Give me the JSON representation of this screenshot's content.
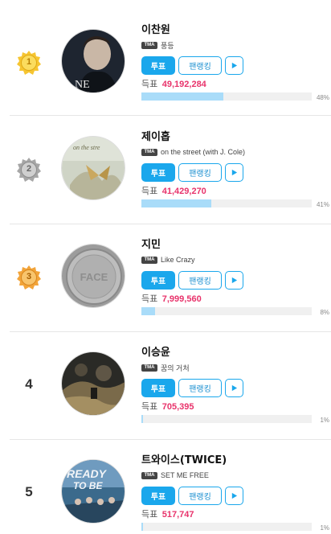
{
  "labels": {
    "vote_button": "투표",
    "fan_ranking_button": "팬랭킹",
    "votes_label": "득표",
    "badge": "TMA"
  },
  "colors": {
    "accent": "#1aa7ec",
    "votes_number": "#e8336b",
    "bar_fill": "#a9dcf9"
  },
  "rankings": [
    {
      "rank": "1",
      "medal": "gold",
      "artist": "이찬원",
      "song": "풍등",
      "votes": "49,192,284",
      "percent_label": "48%",
      "percent": 48
    },
    {
      "rank": "2",
      "medal": "silver",
      "artist": "제이홉",
      "song": "on the street (with J. Cole)",
      "votes": "41,429,270",
      "percent_label": "41%",
      "percent": 41
    },
    {
      "rank": "3",
      "medal": "bronze",
      "artist": "지민",
      "song": "Like Crazy",
      "votes": "7,999,560",
      "percent_label": "8%",
      "percent": 8
    },
    {
      "rank": "4",
      "medal": "",
      "artist": "이승윤",
      "song": "꿈의 거처",
      "votes": "705,395",
      "percent_label": "1%",
      "percent": 1
    },
    {
      "rank": "5",
      "medal": "",
      "artist": "트와이스(TWICE)",
      "song": "SET ME FREE",
      "votes": "517,747",
      "percent_label": "1%",
      "percent": 1
    }
  ]
}
